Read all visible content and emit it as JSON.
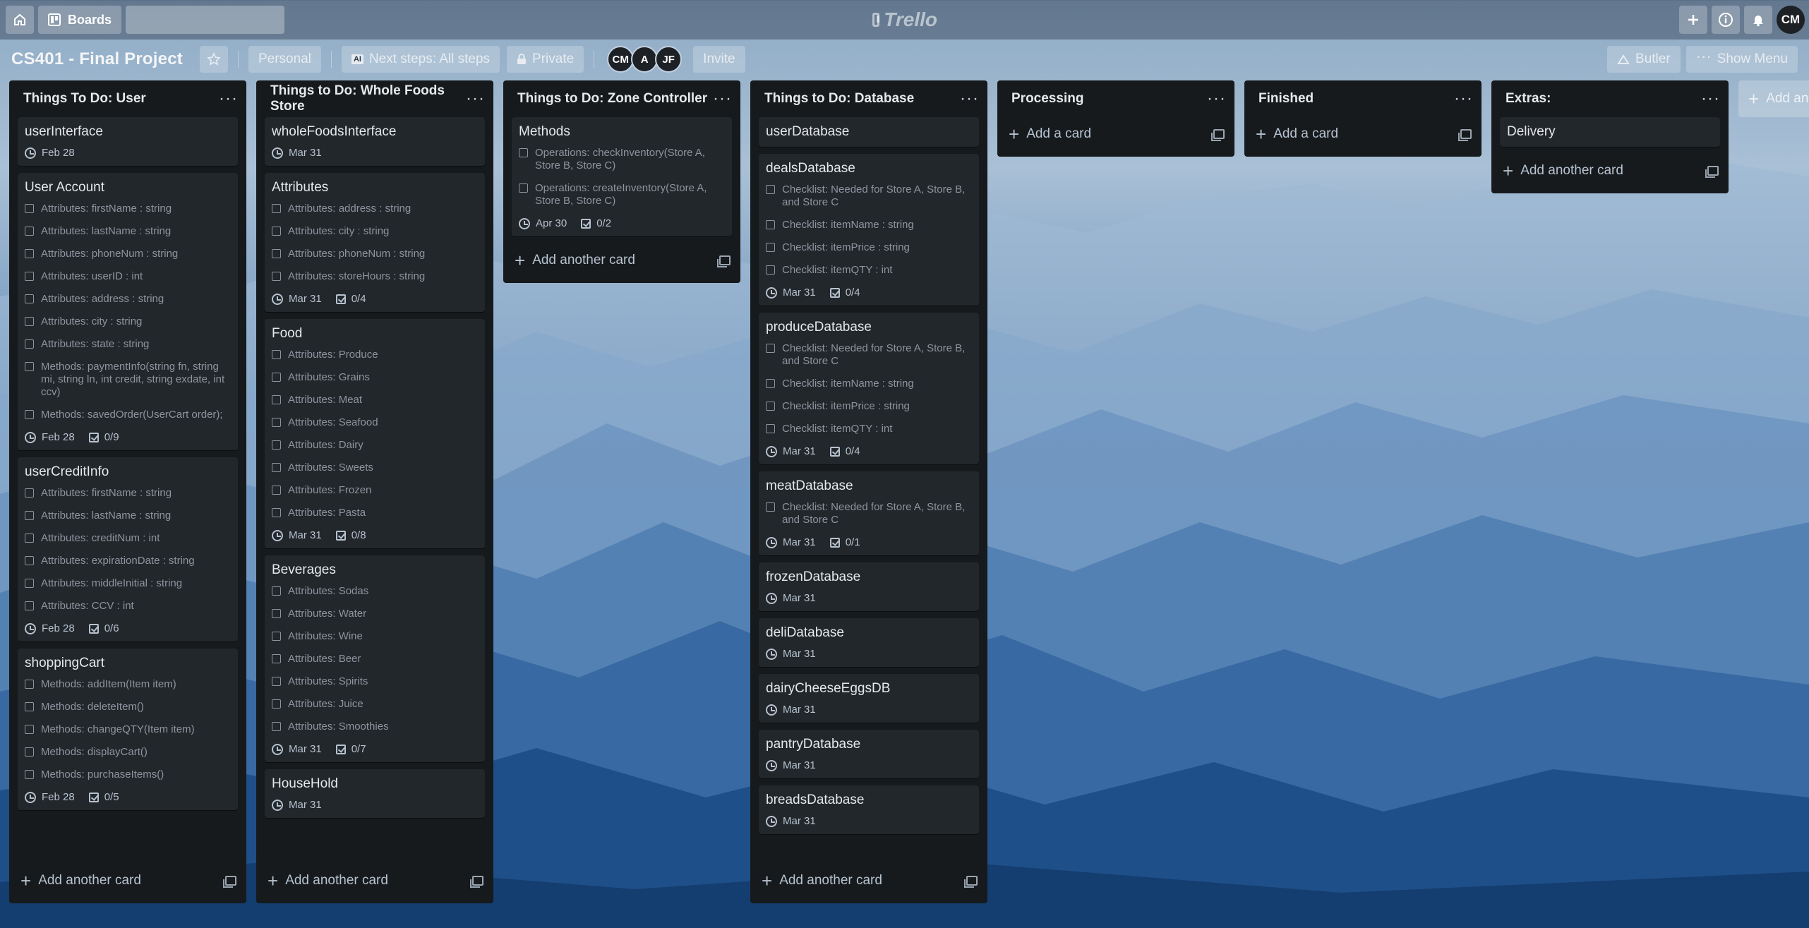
{
  "topbar": {
    "boards_label": "Boards",
    "search_placeholder": "",
    "logo_text": "Trello",
    "user_initials": "CM"
  },
  "board": {
    "title": "CS401 - Final Project",
    "personal_label": "Personal",
    "powerup_badge": "AI",
    "next_steps_label": "Next steps: All steps",
    "private_label": "Private",
    "members": [
      "CM",
      "A",
      "JF"
    ],
    "invite_label": "Invite",
    "butler_label": "Butler",
    "show_menu_label": "Show Menu"
  },
  "lists": [
    {
      "title": "Things To Do: User",
      "footer": "Add another card",
      "cards": [
        {
          "title": "userInterface",
          "checks": [],
          "due": "Feb 28",
          "progress": ""
        },
        {
          "title": "User Account",
          "checks": [
            "Attributes: firstName : string",
            "Attributes: lastName : string",
            "Attributes: phoneNum : string",
            "Attributes: userID : int",
            "Attributes: address : string",
            "Attributes: city : string",
            "Attributes: state : string",
            "Methods: paymentInfo(string fn, string mi, string ln, int credit, string exdate, int ccv)",
            "Methods: savedOrder(UserCart order);"
          ],
          "due": "Feb 28",
          "progress": "0/9"
        },
        {
          "title": "userCreditInfo",
          "checks": [
            "Attributes: firstName : string",
            "Attributes: lastName : string",
            "Attributes: creditNum : int",
            "Attributes: expirationDate : string",
            "Attributes: middleInitial : string",
            "Attributes: CCV : int"
          ],
          "due": "Feb 28",
          "progress": "0/6"
        },
        {
          "title": "shoppingCart",
          "checks": [
            "Methods: addItem(Item item)",
            "Methods: deleteItem()",
            "Methods: changeQTY(Item item)",
            "Methods: displayCart()",
            "Methods: purchaseItems()"
          ],
          "due": "Feb 28",
          "progress": "0/5"
        }
      ]
    },
    {
      "title": "Things to Do: Whole Foods Store",
      "footer": "Add another card",
      "cards": [
        {
          "title": "wholeFoodsInterface",
          "checks": [],
          "due": "Mar 31",
          "progress": ""
        },
        {
          "title": "Attributes",
          "checks": [
            "Attributes: address : string",
            "Attributes: city : string",
            "Attributes: phoneNum : string",
            "Attributes: storeHours : string"
          ],
          "due": "Mar 31",
          "progress": "0/4"
        },
        {
          "title": "Food",
          "checks": [
            "Attributes: Produce",
            "Attributes: Grains",
            "Attributes: Meat",
            "Attributes: Seafood",
            "Attributes: Dairy",
            "Attributes: Sweets",
            "Attributes: Frozen",
            "Attributes: Pasta"
          ],
          "due": "Mar 31",
          "progress": "0/8"
        },
        {
          "title": "Beverages",
          "checks": [
            "Attributes: Sodas",
            "Attributes: Water",
            "Attributes: Wine",
            "Attributes: Beer",
            "Attributes: Spirits",
            "Attributes: Juice",
            "Attributes: Smoothies"
          ],
          "due": "Mar 31",
          "progress": "0/7"
        },
        {
          "title": "HouseHold",
          "checks": [],
          "due": "Mar 31",
          "progress": ""
        }
      ]
    },
    {
      "title": "Things to Do: Zone Controller",
      "footer": "Add another card",
      "cards": [
        {
          "title": "Methods",
          "checks": [
            "Operations: checkInventory(Store A, Store B, Store C)",
            "Operations: createInventory(Store A, Store B, Store C)"
          ],
          "due": "Apr 30",
          "progress": "0/2"
        }
      ]
    },
    {
      "title": "Things to Do: Database",
      "footer": "Add another card",
      "cards": [
        {
          "title": "userDatabase",
          "checks": [],
          "due": "",
          "progress": ""
        },
        {
          "title": "dealsDatabase",
          "checks": [
            "Checklist: Needed for Store A, Store B, and Store C",
            "Checklist: itemName : string",
            "Checklist: itemPrice : string",
            "Checklist: itemQTY : int"
          ],
          "due": "Mar 31",
          "progress": "0/4"
        },
        {
          "title": "produceDatabase",
          "checks": [
            "Checklist: Needed for Store A, Store B, and Store C",
            "Checklist: itemName : string",
            "Checklist: itemPrice : string",
            "Checklist: itemQTY : int"
          ],
          "due": "Mar 31",
          "progress": "0/4"
        },
        {
          "title": "meatDatabase",
          "checks": [
            "Checklist: Needed for Store A, Store B, and Store C"
          ],
          "due": "Mar 31",
          "progress": "0/1"
        },
        {
          "title": "frozenDatabase",
          "checks": [],
          "due": "Mar 31",
          "progress": ""
        },
        {
          "title": "deliDatabase",
          "checks": [],
          "due": "Mar 31",
          "progress": ""
        },
        {
          "title": "dairyCheeseEggsDB",
          "checks": [],
          "due": "Mar 31",
          "progress": ""
        },
        {
          "title": "pantryDatabase",
          "checks": [],
          "due": "Mar 31",
          "progress": ""
        },
        {
          "title": "breadsDatabase",
          "checks": [],
          "due": "Mar 31",
          "progress": ""
        }
      ]
    },
    {
      "title": "Processing",
      "footer": "Add a card",
      "cards": []
    },
    {
      "title": "Finished",
      "footer": "Add a card",
      "cards": []
    },
    {
      "title": "Extras:",
      "footer": "Add another card",
      "cards": [
        {
          "title": "Delivery",
          "checks": [],
          "due": "",
          "progress": ""
        }
      ]
    }
  ],
  "add_list_label": "Add another list"
}
